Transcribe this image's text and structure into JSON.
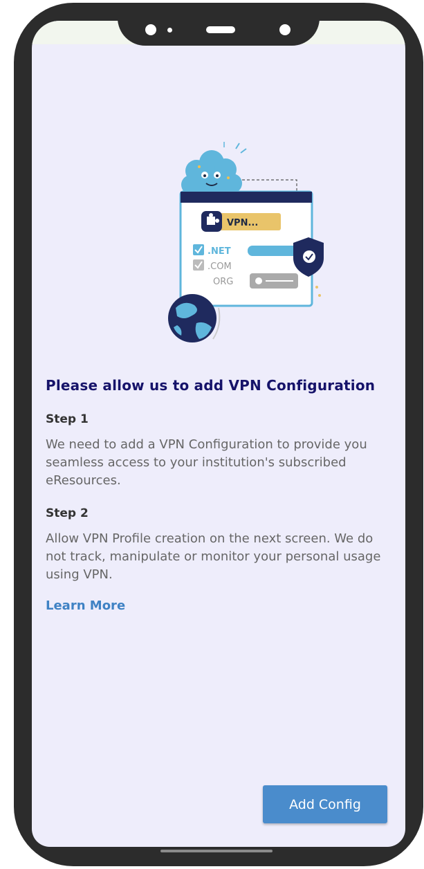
{
  "dialog": {
    "title": "Please allow us to add VPN Configuration",
    "step1": {
      "label": "Step 1",
      "text": "We need to add a VPN Configuration to provide you seamless access to your institution's subscribed eResources."
    },
    "step2": {
      "label": "Step 2",
      "text": "Allow VPN Profile creation on the next screen. We do not track, manipulate or monitor your personal usage using VPN."
    },
    "learn_more": "Learn More",
    "add_config_label": "Add Config"
  },
  "illustration": {
    "vpn_label": "VPN...",
    "domains": [
      ".NET",
      ".COM",
      "ORG"
    ]
  },
  "colors": {
    "background": "#eeedfb",
    "title": "#16136a",
    "accent": "#4a8ccc",
    "link": "#3f82c4"
  },
  "icons": [
    "puzzle-icon",
    "shield-check-icon",
    "globe-icon",
    "checkbox-checked-icon",
    "mascot-cloud-icon"
  ]
}
